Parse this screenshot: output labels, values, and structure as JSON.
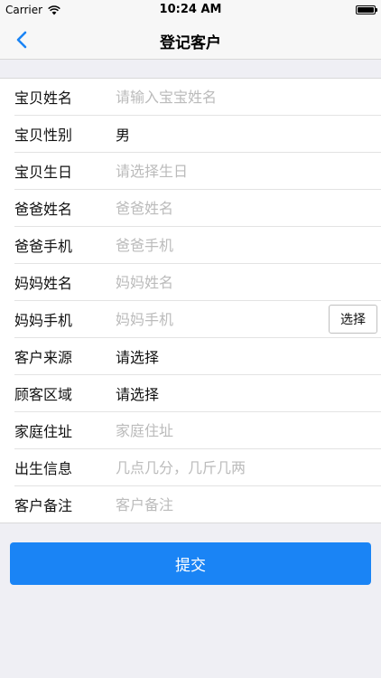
{
  "status_bar": {
    "carrier": "Carrier",
    "time": "10:24 AM"
  },
  "nav": {
    "title": "登记客户",
    "back_icon": "chevron-left-icon"
  },
  "form": {
    "rows": [
      {
        "label": "宝贝姓名",
        "type": "input",
        "value": "",
        "placeholder": "请输入宝宝姓名"
      },
      {
        "label": "宝贝性别",
        "type": "select",
        "value": "男"
      },
      {
        "label": "宝贝生日",
        "type": "input",
        "value": "",
        "placeholder": "请选择生日"
      },
      {
        "label": "爸爸姓名",
        "type": "input",
        "value": "",
        "placeholder": "爸爸姓名"
      },
      {
        "label": "爸爸手机",
        "type": "input",
        "value": "",
        "placeholder": "爸爸手机"
      },
      {
        "label": "妈妈姓名",
        "type": "input",
        "value": "",
        "placeholder": "妈妈姓名"
      },
      {
        "label": "妈妈手机",
        "type": "input",
        "value": "",
        "placeholder": "妈妈手机",
        "button": "选择"
      },
      {
        "label": "客户来源",
        "type": "select",
        "value": "请选择"
      },
      {
        "label": "顾客区域",
        "type": "select",
        "value": "请选择"
      },
      {
        "label": "家庭住址",
        "type": "input",
        "value": "",
        "placeholder": "家庭住址"
      },
      {
        "label": "出生信息",
        "type": "input",
        "value": "",
        "placeholder": "几点几分，几斤几两"
      },
      {
        "label": "客户备注",
        "type": "input",
        "value": "",
        "placeholder": "客户备注"
      }
    ]
  },
  "submit_label": "提交",
  "colors": {
    "accent": "#1a84f5",
    "background": "#efeff4",
    "placeholder": "#bbbbbb"
  }
}
